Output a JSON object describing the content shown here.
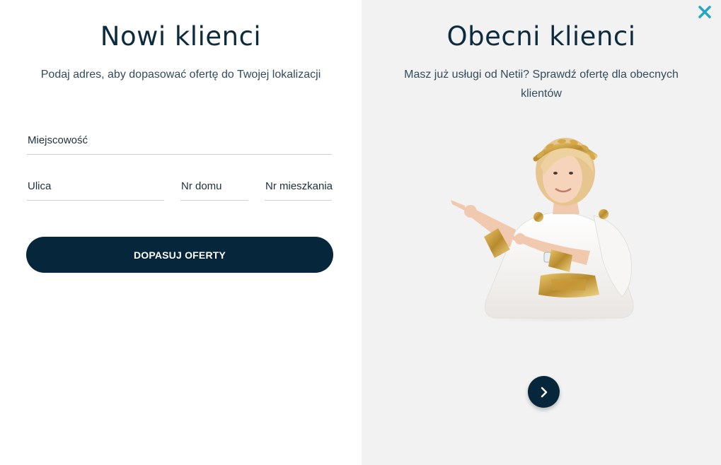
{
  "new_clients": {
    "title": "Nowi klienci",
    "subtitle": "Podaj adres, aby dopasować ofertę do Twojej lokalizacji",
    "fields": {
      "city": {
        "label": "Miejscowość",
        "value": ""
      },
      "street": {
        "label": "Ulica",
        "value": ""
      },
      "house_no": {
        "label": "Nr domu",
        "value": ""
      },
      "flat_no": {
        "label": "Nr mieszkania",
        "value": ""
      }
    },
    "submit_label": "DOPASUJ OFERTY"
  },
  "existing_clients": {
    "title": "Obecni klienci",
    "subtitle": "Masz już usługi od Netii? Sprawdź ofertę dla obecnych klientów",
    "image": "woman-goddess-costume-pointing",
    "next_icon": "chevron-right-icon"
  },
  "close_icon": "close-icon",
  "colors": {
    "primary_dark": "#06263b",
    "accent_close": "#1fa9c4",
    "right_bg": "#f2f2f2"
  }
}
